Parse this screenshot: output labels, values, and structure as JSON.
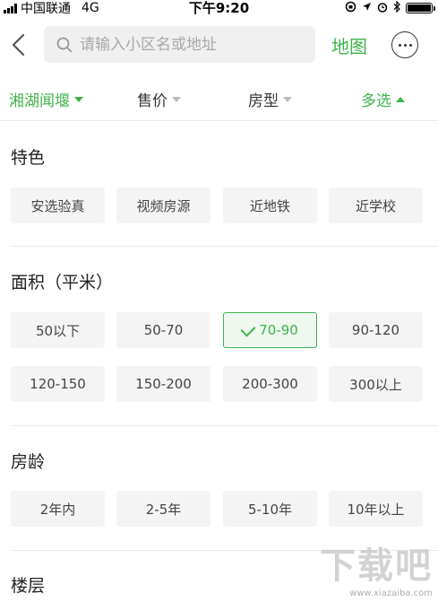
{
  "status_bar": {
    "carrier": "中国联通",
    "network": "4G",
    "time": "下午9:20"
  },
  "nav": {
    "search_placeholder": "请输入小区名或地址",
    "map_label": "地图"
  },
  "filters": [
    {
      "label": "湘湖闻堰",
      "active": true
    },
    {
      "label": "售价",
      "active": false
    },
    {
      "label": "房型",
      "active": false
    },
    {
      "label": "多选",
      "active": true
    }
  ],
  "sections": {
    "features": {
      "title": "特色",
      "options": [
        "安选验真",
        "视频房源",
        "近地铁",
        "近学校"
      ]
    },
    "area": {
      "title": "面积（平米）",
      "options": [
        "50以下",
        "50-70",
        "70-90",
        "90-120",
        "120-150",
        "150-200",
        "200-300",
        "300以上"
      ],
      "selected": "70-90"
    },
    "age": {
      "title": "房龄",
      "options": [
        "2年内",
        "2-5年",
        "5-10年",
        "10年以上"
      ]
    },
    "floor": {
      "title": "楼层"
    }
  },
  "watermark": {
    "text": "下载吧",
    "url": "www.xiazaiba.com"
  },
  "colors": {
    "accent": "#3db24b",
    "chip_bg": "#f4f4f4"
  }
}
